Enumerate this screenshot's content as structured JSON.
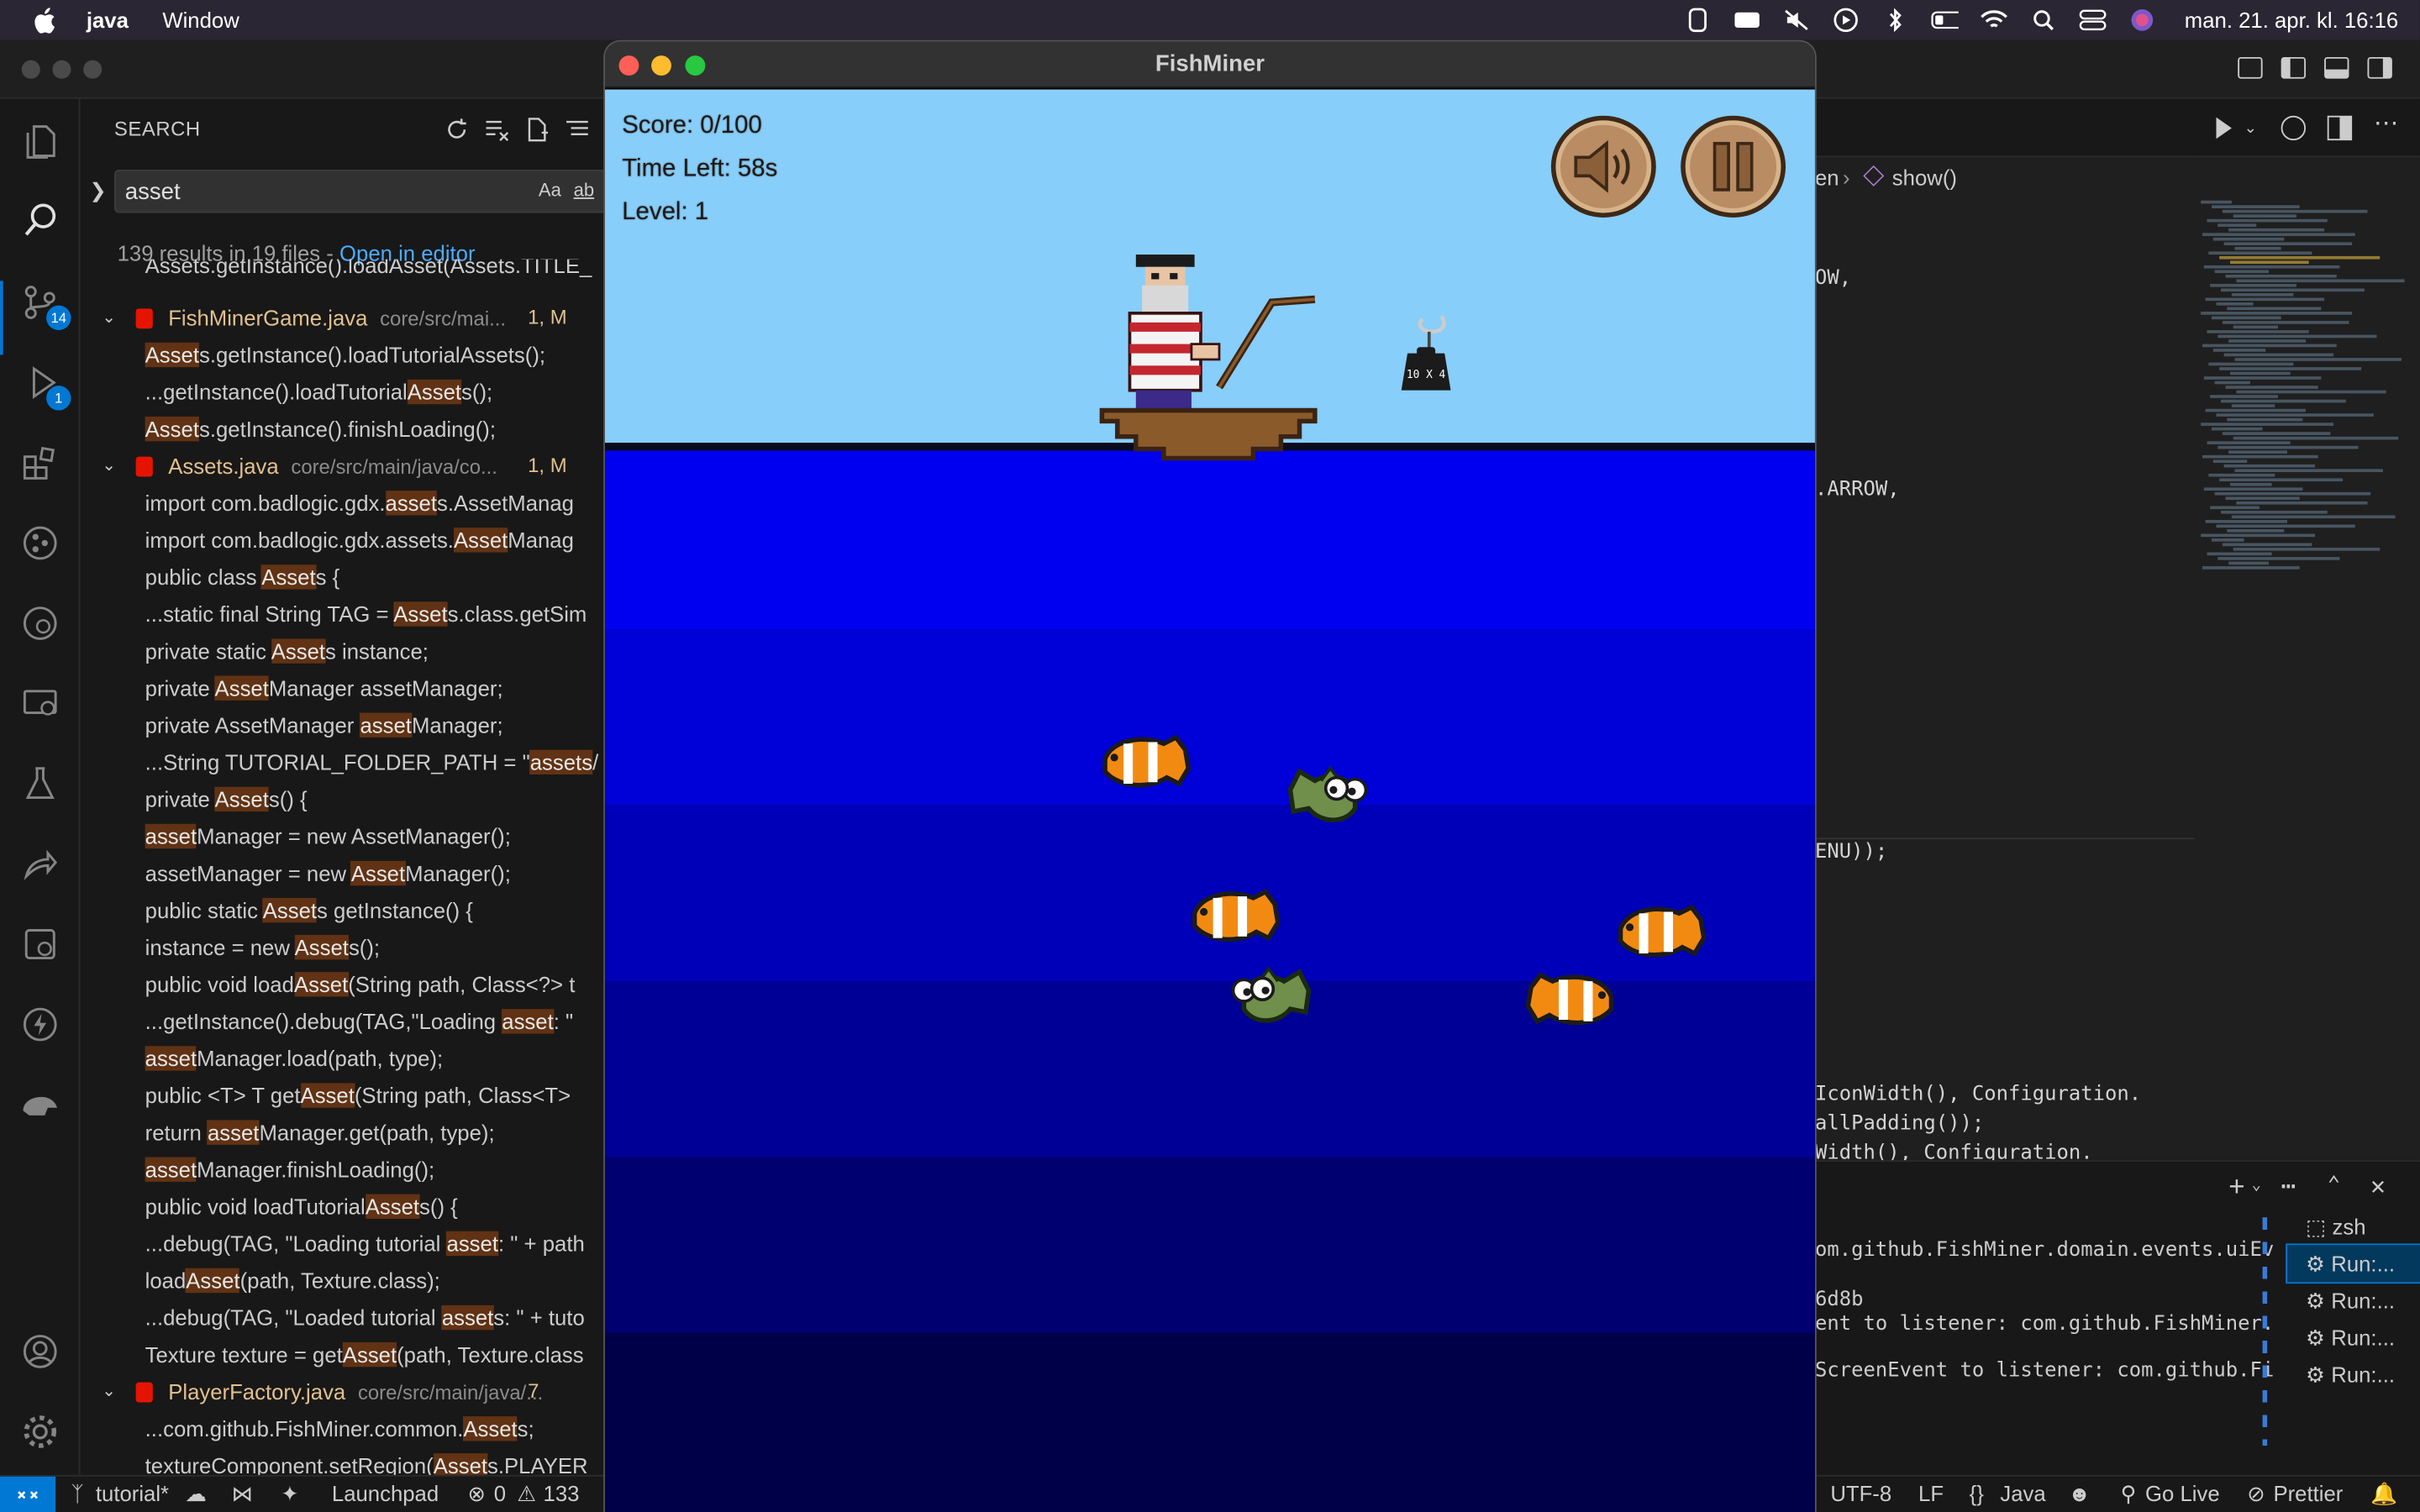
{
  "menubar": {
    "app_name": "java",
    "menu_window": "Window",
    "clock": "man. 21. apr. kl. 16:16"
  },
  "activity_bar": {
    "source_control_badge": "14",
    "debug_badge": "1"
  },
  "search_panel": {
    "title": "SEARCH",
    "query": "asset",
    "case_option": "Aa",
    "word_option": "ab",
    "result_summary": "139 results in 19 files - ",
    "open_in_editor": "Open in editor",
    "rows": [
      {
        "type": "partial",
        "text": "Assets.getInstance().loadAsset(Assets.TITLE_"
      },
      {
        "type": "file",
        "name": "FishMinerGame.java",
        "path": "core/src/mai...",
        "count": "1, M"
      },
      {
        "type": "match",
        "pre": "",
        "hit": "Asset",
        "post": "s.getInstance().loadTutorialAssets();"
      },
      {
        "type": "match",
        "pre": "...getInstance().loadTutorial",
        "hit": "Asset",
        "post": "s();"
      },
      {
        "type": "match",
        "pre": "",
        "hit": "Asset",
        "post": "s.getInstance().finishLoading();"
      },
      {
        "type": "file",
        "name": "Assets.java",
        "path": "core/src/main/java/co...",
        "count": "1, M"
      },
      {
        "type": "match",
        "pre": "import com.badlogic.gdx.",
        "hit": "asset",
        "post": "s.AssetManag"
      },
      {
        "type": "match",
        "pre": "import com.badlogic.gdx.assets.",
        "hit": "Asset",
        "post": "Manag"
      },
      {
        "type": "match",
        "pre": "public class ",
        "hit": "Asset",
        "post": "s {"
      },
      {
        "type": "match",
        "pre": "...static final String TAG = ",
        "hit": "Asset",
        "post": "s.class.getSim"
      },
      {
        "type": "match",
        "pre": "private static ",
        "hit": "Asset",
        "post": "s instance;"
      },
      {
        "type": "match",
        "pre": "private ",
        "hit": "Asset",
        "post": "Manager assetManager;"
      },
      {
        "type": "match",
        "pre": "private AssetManager ",
        "hit": "asset",
        "post": "Manager;"
      },
      {
        "type": "match",
        "pre": "...String TUTORIAL_FOLDER_PATH = \"",
        "hit": "assets",
        "post": "/"
      },
      {
        "type": "match",
        "pre": "private ",
        "hit": "Asset",
        "post": "s() {"
      },
      {
        "type": "match",
        "pre": "",
        "hit": "asset",
        "post": "Manager = new AssetManager();"
      },
      {
        "type": "match",
        "pre": "assetManager = new ",
        "hit": "Asset",
        "post": "Manager();"
      },
      {
        "type": "match",
        "pre": "public static ",
        "hit": "Asset",
        "post": "s getInstance() {"
      },
      {
        "type": "match",
        "pre": "instance = new ",
        "hit": "Asset",
        "post": "s();"
      },
      {
        "type": "match",
        "pre": "public void load",
        "hit": "Asset",
        "post": "(String path, Class<?> t"
      },
      {
        "type": "match",
        "pre": "...getInstance().debug(TAG,\"Loading ",
        "hit": "asset",
        "post": ": \""
      },
      {
        "type": "match",
        "pre": "",
        "hit": "asset",
        "post": "Manager.load(path, type);"
      },
      {
        "type": "match",
        "pre": "public <T> T get",
        "hit": "Asset",
        "post": "(String path, Class<T>"
      },
      {
        "type": "match",
        "pre": "return ",
        "hit": "asset",
        "post": "Manager.get(path, type);"
      },
      {
        "type": "match",
        "pre": "",
        "hit": "asset",
        "post": "Manager.finishLoading();"
      },
      {
        "type": "match",
        "pre": "public void loadTutorial",
        "hit": "Asset",
        "post": "s() {"
      },
      {
        "type": "match",
        "pre": "...debug(TAG, \"Loading tutorial ",
        "hit": "asset",
        "post": ": \" + path"
      },
      {
        "type": "match",
        "pre": "load",
        "hit": "Asset",
        "post": "(path, Texture.class);"
      },
      {
        "type": "match",
        "pre": "...debug(TAG, \"Loaded tutorial ",
        "hit": "asset",
        "post": "s: \" + tuto"
      },
      {
        "type": "match",
        "pre": "Texture texture = get",
        "hit": "Asset",
        "post": "(path, Texture.class"
      },
      {
        "type": "file",
        "name": "PlayerFactory.java",
        "path": "core/src/main/java/...",
        "count": "7"
      },
      {
        "type": "match",
        "pre": "...com.github.FishMiner.common.",
        "hit": "Asset",
        "post": "s;"
      },
      {
        "type": "match",
        "pre": "textureComponent.setRegion(",
        "hit": "Asset",
        "post": "s.PLAYER"
      }
    ]
  },
  "editor": {
    "breadcrumb_prefix": "en",
    "breadcrumb_symbol": "show()",
    "code_lines": [
      {
        "text": "OW,",
        "line": 0
      },
      {
        "text": ".ARROW,",
        "line": 1
      },
      {
        "text": "ENU));",
        "line": 2
      },
      {
        "text": "IconWidth(), Configuration.",
        "line": 3
      },
      {
        "text": "allPadding());",
        "line": 4
      },
      {
        "text": "Width(), Configuration.",
        "line": 5
      }
    ]
  },
  "terminal": {
    "lines": [
      "om.github.FishMiner.domain.events.uiEv",
      "6d8b",
      "ent to listener: com.github.FishMiner.",
      "ScreenEvent to listener: com.github.Fi"
    ],
    "tabs": [
      {
        "label": "zsh",
        "selected": false
      },
      {
        "label": "Run:...",
        "selected": true
      },
      {
        "label": "Run:...",
        "selected": false
      },
      {
        "label": "Run:...",
        "selected": false
      },
      {
        "label": "Run:...",
        "selected": false
      }
    ]
  },
  "statusbar": {
    "branch": "tutorial*",
    "launchpad": "Launchpad",
    "errors": "0",
    "warnings": "133",
    "encoding": "UTF-8",
    "eol": "LF",
    "language": "Java",
    "golive": "Go Live",
    "prettier": "Prettier"
  },
  "game": {
    "window_title": "FishMiner",
    "score_text": "Score: 0/100",
    "time_text": "Time Left: 58s",
    "level_text": "Level: 1",
    "weight_label": "10 X 4",
    "sky_color": "#87cefa",
    "water_bands": [
      "#0000f0",
      "#0000d8",
      "#0000b8",
      "#000096",
      "#000070",
      "#000048"
    ],
    "fish": [
      {
        "kind": "clownfish",
        "facing": "right"
      },
      {
        "kind": "green-fish",
        "facing": "left"
      },
      {
        "kind": "clownfish",
        "facing": "right"
      },
      {
        "kind": "clownfish",
        "facing": "right"
      },
      {
        "kind": "green-fish",
        "facing": "right"
      },
      {
        "kind": "clownfish",
        "facing": "left"
      }
    ],
    "sound_icon": "speaker-icon",
    "pause_icon": "pause-icon"
  }
}
